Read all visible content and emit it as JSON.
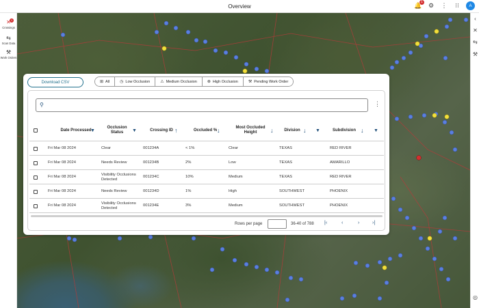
{
  "header": {
    "title": "Overview",
    "notification_count": "1",
    "avatar_initial": "A"
  },
  "leftnav": [
    {
      "label": "Crossings",
      "badge": "1"
    },
    {
      "label": "Scan Data"
    },
    {
      "label": "Work Orders"
    }
  ],
  "toolbar": {
    "download_label": "Download CSV"
  },
  "filters": [
    {
      "label": "All",
      "icon": "all-icon"
    },
    {
      "label": "Low Occlusion",
      "icon": "clock-icon"
    },
    {
      "label": "Medium Occlusion",
      "icon": "warning-icon"
    },
    {
      "label": "High Occlusion",
      "icon": "circle-x-icon"
    },
    {
      "label": "Pending Work Order",
      "icon": "tools-icon"
    }
  ],
  "search": {
    "placeholder": "",
    "value": ""
  },
  "table": {
    "columns": [
      "Date Processed",
      "Occlusion Status",
      "Crossing ID",
      "Occluded %",
      "Most Occluded Height",
      "Division",
      "Subdivision"
    ],
    "rows": [
      [
        "Fri Mar 08 2024",
        "Clear",
        "001234A",
        "< 1%",
        "Clear",
        "TEXAS",
        "RED RIVER"
      ],
      [
        "Fri Mar 08 2024",
        "Needs Review",
        "001234B",
        "2%",
        "Low",
        "TEXAS",
        "AMARILLO"
      ],
      [
        "Fri Mar 08 2024",
        "Visibility Occlusions Detected",
        "001234C",
        "10%",
        "Medium",
        "TEXAS",
        "RED RIVER"
      ],
      [
        "Fri Mar 08 2024",
        "Needs Review",
        "001234D",
        "1%",
        "High",
        "SOUTHWEST",
        "PHOENIX"
      ],
      [
        "Fri Mar 08 2024",
        "Visibility Occlusions Detected",
        "001234E",
        "3%",
        "Medium",
        "SOUTHWEST",
        "PHOENIX"
      ]
    ]
  },
  "pagination": {
    "rows_per_page_label": "Rows per page",
    "rows_per_page_value": "",
    "range": "36-40 of 788"
  },
  "colors": {
    "accent": "#1f6f8b",
    "pin_blue": "#5b7fe0",
    "pin_yellow": "#f3e03b",
    "pin_red": "#d32f2f"
  }
}
